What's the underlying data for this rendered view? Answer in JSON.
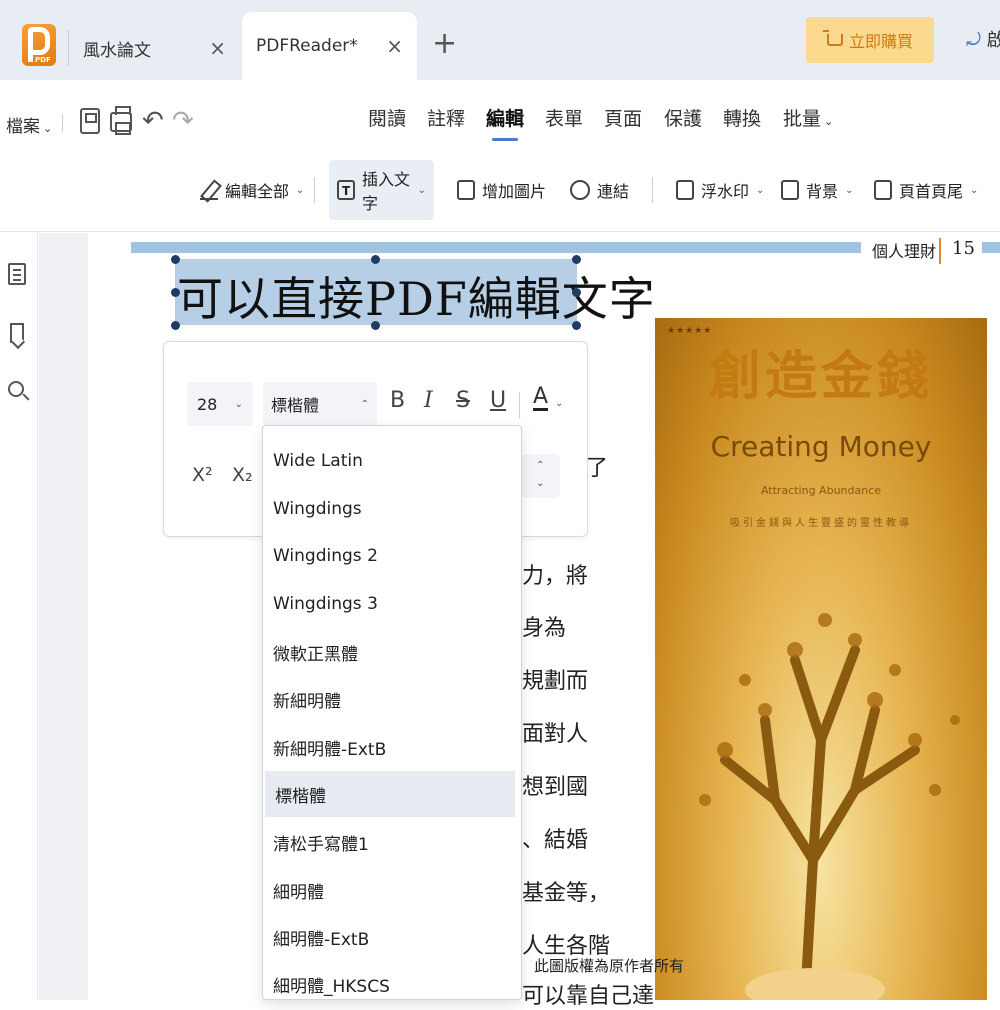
{
  "tabs": {
    "items": [
      {
        "label": "風水論文",
        "close": "×"
      },
      {
        "label": "PDFReader*",
        "close": "×"
      }
    ],
    "new_tab": "+",
    "buy_label": "立即購買",
    "top_right_label": "啟",
    "logo_sub": "PDF"
  },
  "menubar": {
    "file": "檔案",
    "items": [
      "閱讀",
      "註釋",
      "編輯",
      "表單",
      "頁面",
      "保護",
      "轉換",
      "批量"
    ],
    "active": "編輯"
  },
  "toolbar": {
    "edit_all": "編輯全部",
    "insert_text": "插入文字",
    "add_image": "增加圖片",
    "link": "連結",
    "watermark": "浮水印",
    "background": "背景",
    "header_footer": "頁首頁尾"
  },
  "document": {
    "running_head": "個人理財",
    "page_number": "15",
    "selected_heading": "可以直接PDF編輯文字",
    "body_lines": [
      "了",
      "力，將",
      "身為",
      "規劃而",
      "面對人",
      "想到國",
      "、結婚",
      "基金等，",
      "人生各階",
      "可以靠自己達"
    ],
    "copyright": "此圖版權為原作者所有",
    "cover": {
      "stars": "★★★★★",
      "title": "創造金錢",
      "subtitle": "Creating Money",
      "tagline": "Attracting Abundance",
      "caption": "吸引金錢與人生豐盛的靈性教導"
    }
  },
  "text_toolbar": {
    "font_size": "28",
    "font_family": "標楷體",
    "bold": "B",
    "italic": "I",
    "strike": "S",
    "underline": "U",
    "color": "A",
    "superscript": "X²",
    "subscript": "X₂"
  },
  "font_dropdown": {
    "items": [
      "Wide Latin",
      "Wingdings",
      "Wingdings 2",
      "Wingdings 3",
      "微軟正黑體",
      "新細明體",
      "新細明體-ExtB",
      "標楷體",
      "清松手寫體1",
      "細明體",
      "細明體-ExtB",
      "細明體_HKSCS"
    ],
    "selected": "標楷體"
  },
  "colors": {
    "accent": "#4a79c9",
    "buy_button": "#fbd98f",
    "selection": "#b7cfe6"
  }
}
